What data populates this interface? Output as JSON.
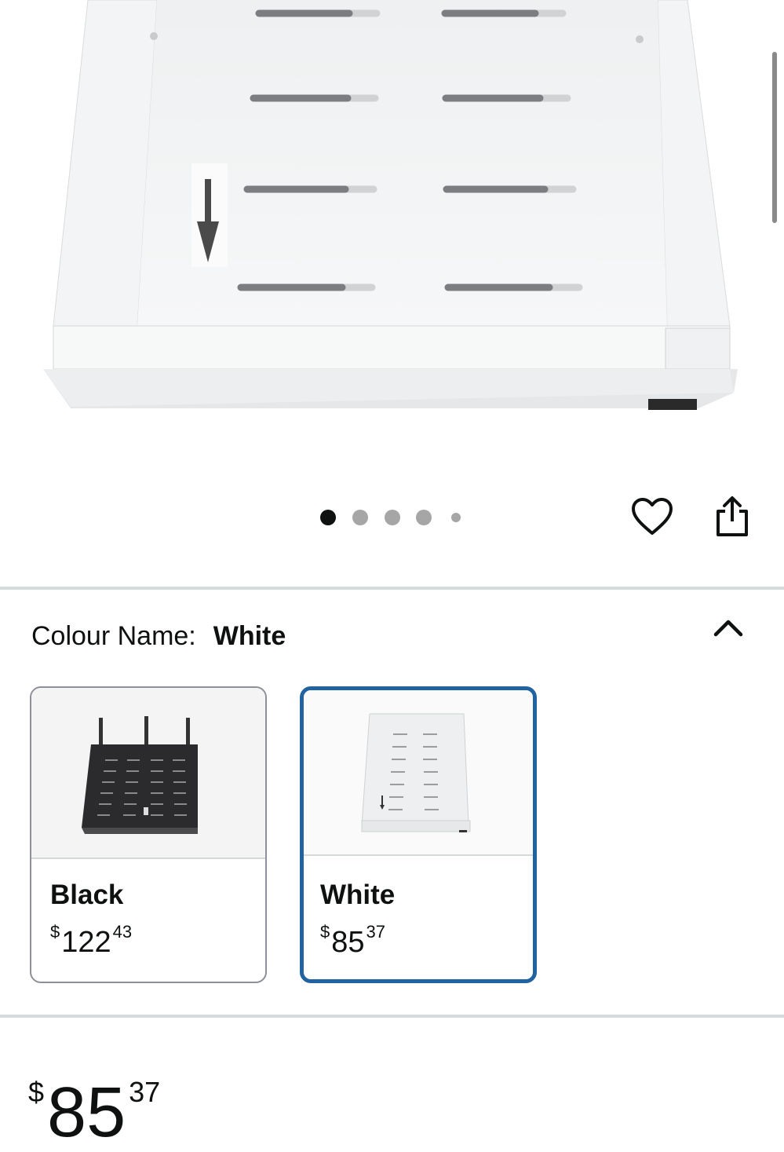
{
  "gallery": {
    "image_count": 5,
    "active_index": 0,
    "wishlist_icon": "heart-icon",
    "share_icon": "share-icon"
  },
  "variation": {
    "label": "Colour Name:",
    "selected_value": "White",
    "collapse_icon": "chevron-up-icon",
    "options": [
      {
        "name": "Black",
        "currency": "$",
        "whole": "122",
        "fraction": "43",
        "selected": false
      },
      {
        "name": "White",
        "currency": "$",
        "whole": "85",
        "fraction": "37",
        "selected": true
      }
    ]
  },
  "price": {
    "currency": "$",
    "whole": "85",
    "fraction": "37"
  },
  "colors": {
    "selected_border": "#2162a1",
    "divider": "#d5dbdb",
    "text": "#0f1111"
  }
}
